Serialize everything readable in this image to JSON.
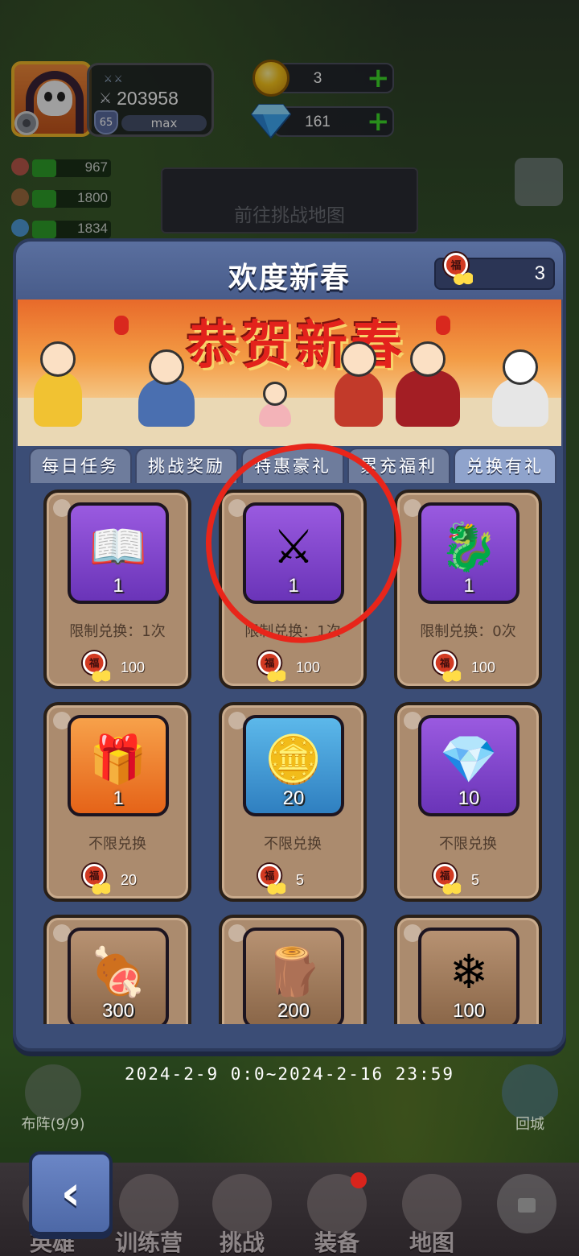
{
  "hud": {
    "power": "203958",
    "level": "65",
    "level_status": "max",
    "gold": "3",
    "diamonds": "161",
    "side_stats": [
      "967",
      "1800",
      "1834"
    ],
    "map_button_label": "前往挑战地图"
  },
  "event": {
    "title": "欢度新春",
    "token_count": "3",
    "banner_text": "恭贺新春",
    "tabs": [
      "每日任务",
      "挑战奖励",
      "特惠豪礼",
      "累充福利",
      "兑换有礼"
    ],
    "active_tab_index": 4,
    "items": [
      {
        "icon": "nurse-hero-icon",
        "glyph": "📖",
        "bg": "purple",
        "qty": "1",
        "limit": "限制兑换：1次",
        "price": "100"
      },
      {
        "icon": "golden-warrior-hero-icon",
        "glyph": "⚔",
        "bg": "purple",
        "qty": "1",
        "limit": "限制兑换：1次",
        "price": "100"
      },
      {
        "icon": "dragon-girl-hero-icon",
        "glyph": "🐉",
        "bg": "purple",
        "qty": "1",
        "limit": "限制兑换：0次",
        "price": "100"
      },
      {
        "icon": "gift-box-icon",
        "glyph": "🎁",
        "bg": "orange",
        "qty": "1",
        "limit": "不限兑换",
        "price": "20"
      },
      {
        "icon": "gold-coin-icon",
        "glyph": "🪙",
        "bg": "blue",
        "qty": "20",
        "limit": "不限兑换",
        "price": "5"
      },
      {
        "icon": "diamond-icon",
        "glyph": "💎",
        "bg": "purple",
        "qty": "10",
        "limit": "不限兑换",
        "price": "5"
      },
      {
        "icon": "meat-icon",
        "glyph": "🍖",
        "bg": "brown",
        "qty": "300",
        "limit": "",
        "price": ""
      },
      {
        "icon": "wood-log-icon",
        "glyph": "🪵",
        "bg": "brown",
        "qty": "200",
        "limit": "",
        "price": ""
      },
      {
        "icon": "crystal-icon",
        "glyph": "❄",
        "bg": "brown",
        "qty": "100",
        "limit": "",
        "price": ""
      }
    ],
    "date_range": "2024-2-9 0:0~2024-2-16 23:59"
  },
  "bottom": {
    "formation_label": "布阵(9/9)",
    "return_label": "回城",
    "nav": [
      "英雄",
      "训练营",
      "挑战",
      "装备",
      "地图"
    ]
  },
  "colors": {
    "annotation_circle": "#e8251a",
    "modal_bg": "#3b4d76",
    "card_bg": "#ab8b6e",
    "plus_green": "#3edb2a"
  }
}
